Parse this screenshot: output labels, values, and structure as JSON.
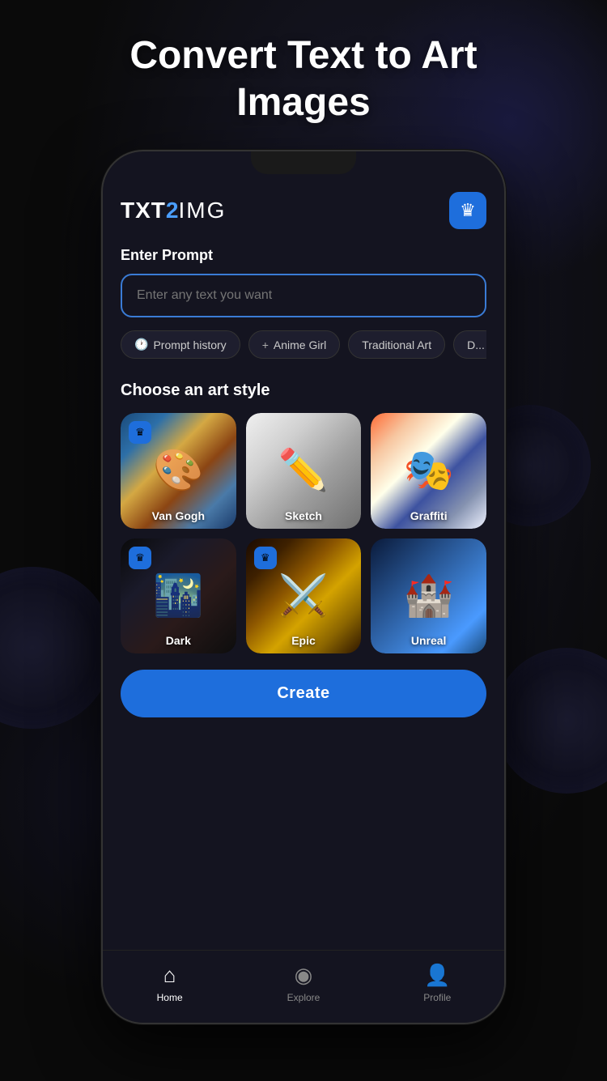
{
  "page": {
    "title_line1": "Convert Text to Art",
    "title_line2": "Images"
  },
  "app": {
    "logo": {
      "txt": "TXT",
      "two": "2",
      "img": "IMG"
    },
    "crown_button_label": "👑",
    "prompt_section": {
      "label": "Enter Prompt",
      "input_placeholder": "Enter any text you want"
    },
    "chips": [
      {
        "id": "history",
        "icon": "🕐",
        "label": "Prompt history"
      },
      {
        "id": "anime",
        "icon": "+",
        "label": "Anime Girl"
      },
      {
        "id": "traditional",
        "icon": "",
        "label": "Traditional Art"
      },
      {
        "id": "more",
        "icon": "",
        "label": "D..."
      }
    ],
    "art_style_section": {
      "label": "Choose an art style"
    },
    "art_styles": [
      {
        "id": "vangogh",
        "label": "Van Gogh",
        "has_crown": true,
        "style_class": "art-vangogh"
      },
      {
        "id": "sketch",
        "label": "Sketch",
        "has_crown": false,
        "style_class": "art-sketch"
      },
      {
        "id": "graffiti",
        "label": "Graffiti",
        "has_crown": false,
        "style_class": "art-graffiti"
      },
      {
        "id": "dark",
        "label": "Dark",
        "has_crown": true,
        "style_class": "art-dark"
      },
      {
        "id": "epic",
        "label": "Epic",
        "has_crown": true,
        "style_class": "art-epic"
      },
      {
        "id": "unreal",
        "label": "Unreal",
        "has_crown": false,
        "style_class": "art-unreal"
      }
    ],
    "create_button": "Create",
    "bottom_nav": [
      {
        "id": "home",
        "icon": "⌂",
        "label": "Home",
        "active": true
      },
      {
        "id": "explore",
        "icon": "◎",
        "label": "Explore",
        "active": false
      },
      {
        "id": "profile",
        "icon": "👤",
        "label": "Profile",
        "active": false
      }
    ]
  }
}
